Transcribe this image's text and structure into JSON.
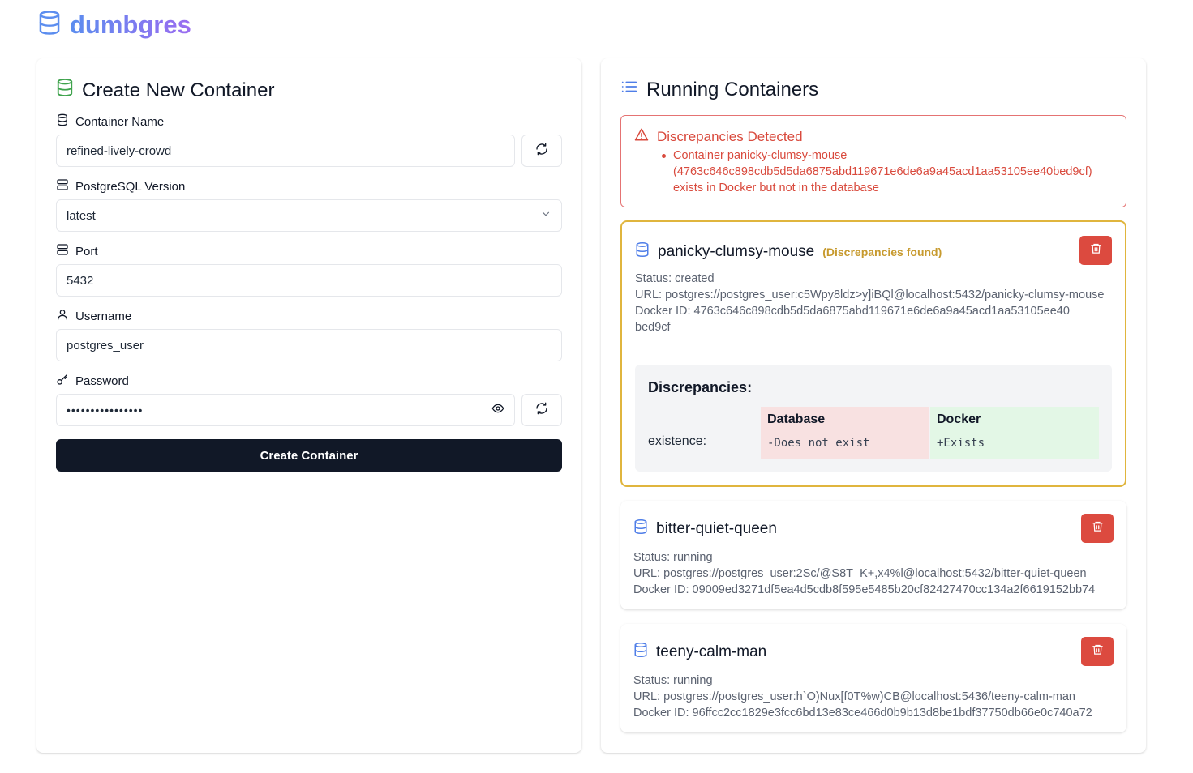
{
  "app": {
    "title": "dumbgres"
  },
  "create": {
    "title": "Create New Container",
    "fields": {
      "name": {
        "label": "Container Name",
        "value": "refined-lively-crowd"
      },
      "version": {
        "label": "PostgreSQL Version",
        "value": "latest"
      },
      "port": {
        "label": "Port",
        "value": "5432"
      },
      "username": {
        "label": "Username",
        "value": "postgres_user"
      },
      "password": {
        "label": "Password",
        "value": "••••••••••••••••"
      }
    },
    "submit_label": "Create Container"
  },
  "running": {
    "title": "Running Containers",
    "alert": {
      "title": "Discrepancies Detected",
      "items": [
        "Container panicky-clumsy-mouse (4763c646c898cdb5d5da6875abd119671e6de6a9a45acd1aa53105ee40bed9cf) exists in Docker but not in the database"
      ]
    },
    "containers": [
      {
        "name": "panicky-clumsy-mouse",
        "warning": "(Discrepancies found)",
        "status": "Status: created",
        "url": "URL: postgres://postgres_user:c5Wpy8ldz>y]iBQl@localhost:5432/panicky-clumsy-mouse",
        "docker_id": "Docker ID: 4763c646c898cdb5d5da6875abd119671e6de6a9a45acd1aa53105ee40bed9cf",
        "discrepancies": {
          "title": "Discrepancies:",
          "key": "existence:",
          "db_header": "Database",
          "db_value": "-Does not exist",
          "docker_header": "Docker",
          "docker_value": "+Exists"
        }
      },
      {
        "name": "bitter-quiet-queen",
        "status": "Status: running",
        "url": "URL: postgres://postgres_user:2Sc/@S8T_K+,x4%l@localhost:5432/bitter-quiet-queen",
        "docker_id": "Docker ID: 09009ed3271df5ea4d5cdb8f595e5485b20cf82427470cc134a2f6619152bb74"
      },
      {
        "name": "teeny-calm-man",
        "status": "Status: running",
        "url": "URL: postgres://postgres_user:h`O)Nux[f0T%w)CB@localhost:5436/teeny-calm-man",
        "docker_id": "Docker ID: 96ffcc2cc1829e3fcc6bd13e83ce466d0b9b13d8be1bdf37750db66e0c740a72"
      }
    ]
  },
  "colors": {
    "brand_from": "#5b8def",
    "brand_to": "#9b6cf0",
    "primary": "#111827",
    "danger": "#dc4a3f",
    "warning": "#e0b53d",
    "db_icon": "#4f7ee8",
    "create_icon": "#3fa34d"
  }
}
